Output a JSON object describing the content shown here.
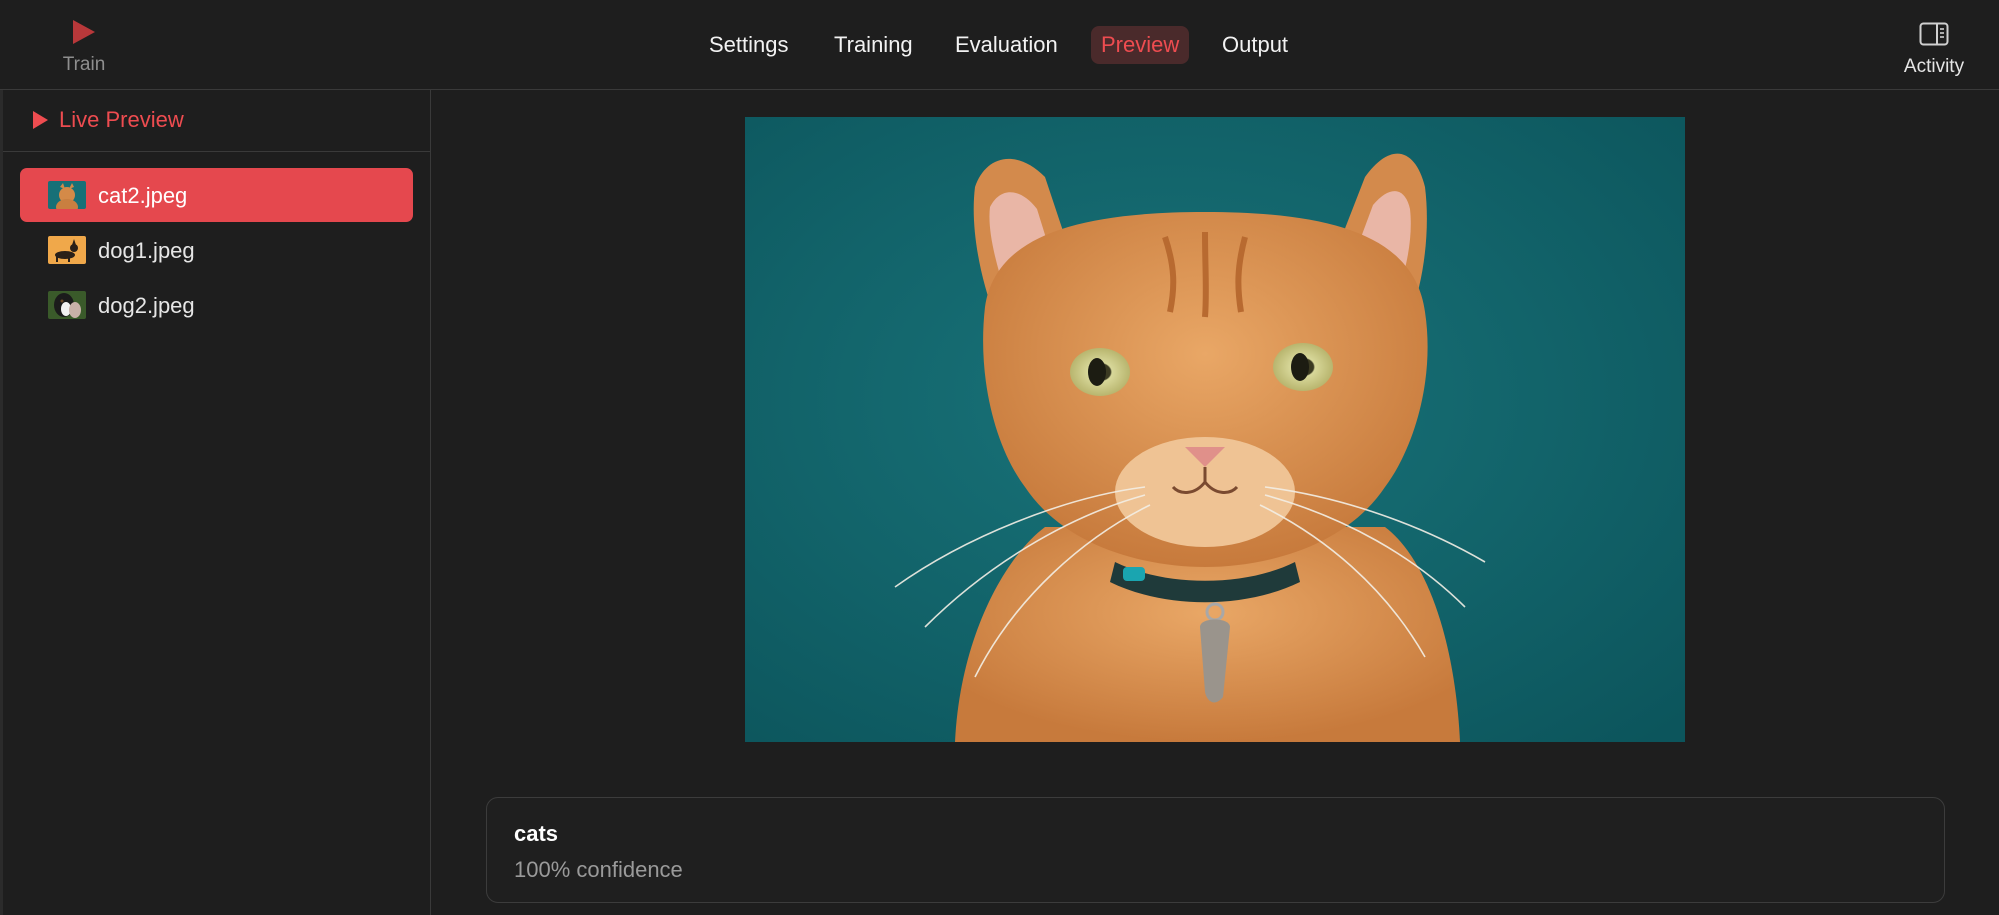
{
  "toolbar": {
    "train_label": "Train",
    "activity_label": "Activity",
    "tabs": [
      {
        "label": "Settings"
      },
      {
        "label": "Training"
      },
      {
        "label": "Evaluation"
      },
      {
        "label": "Preview",
        "active": true
      },
      {
        "label": "Output"
      }
    ]
  },
  "sidebar": {
    "live_preview_label": "Live Preview",
    "files": [
      {
        "name": "cat2.jpeg",
        "selected": true,
        "thumb": "cat-thumbnail"
      },
      {
        "name": "dog1.jpeg",
        "selected": false,
        "thumb": "dog-thumbnail"
      },
      {
        "name": "dog2.jpeg",
        "selected": false,
        "thumb": "dog-thumbnail"
      }
    ]
  },
  "preview": {
    "image": "orange-tabby-cat-on-teal-background"
  },
  "result": {
    "label": "cats",
    "confidence": "100% confidence"
  },
  "colors": {
    "accent": "#e5484e",
    "accent_text": "#ee4c50",
    "background": "#1e1e1e",
    "image_background": "#11646a"
  }
}
